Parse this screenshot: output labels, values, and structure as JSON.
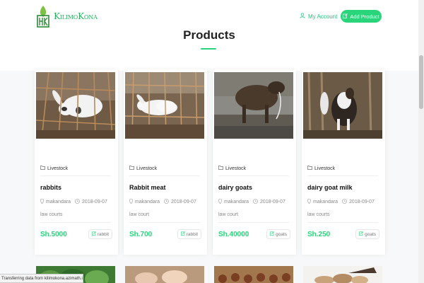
{
  "header": {
    "logo_text": "KilimoKona",
    "account_label": "My Account",
    "add_product_label": "Add Product"
  },
  "page": {
    "title": "Products"
  },
  "products": [
    {
      "category": "Livestock",
      "name": "rabbits",
      "location": "makandara",
      "date": "2018-09-07",
      "address": "law courts",
      "price": "Sh.5000",
      "tag": "rabbit"
    },
    {
      "category": "Livestock",
      "name": "Rabbit meat",
      "location": "makandara",
      "date": "2018-09-07",
      "address": "law court",
      "price": "Sh.700",
      "tag": "rabbit"
    },
    {
      "category": "Livestock",
      "name": "dairy goats",
      "location": "makandara",
      "date": "2018-09-07",
      "address": "law court",
      "price": "Sh.40000",
      "tag": "goats"
    },
    {
      "category": "Livestock",
      "name": "dairy goat milk",
      "location": "makandara",
      "date": "2018-09-07",
      "address": "law courts",
      "price": "Sh.250",
      "tag": "goats"
    }
  ],
  "status_bar": "Transferring data from kilimokona.azimath.it...",
  "colors": {
    "accent": "#2ad47a",
    "brand_green": "#27ae60"
  }
}
